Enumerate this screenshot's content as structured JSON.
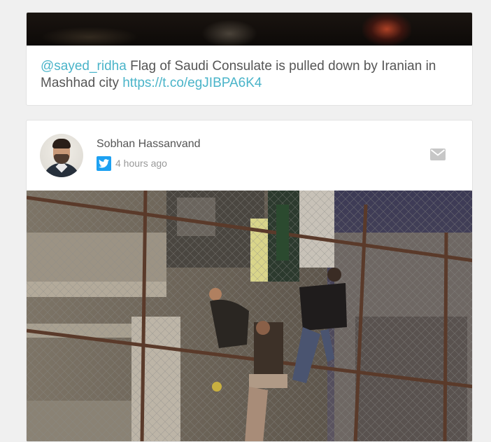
{
  "tweet1": {
    "mention": "@sayed_ridha",
    "text": " Flag of Saudi Consulate is pulled down by Iranian in Mashhad city ",
    "link": "https://t.co/egJIBPA6K4"
  },
  "tweet2": {
    "author": "Sobhan Hassanvand",
    "timestamp": "4 hours ago",
    "source_icon": "twitter-icon",
    "action_icon": "mail-icon"
  },
  "colors": {
    "link": "#4ab4c9",
    "twitter": "#1da1f2",
    "text": "#555555",
    "muted": "#999999"
  }
}
